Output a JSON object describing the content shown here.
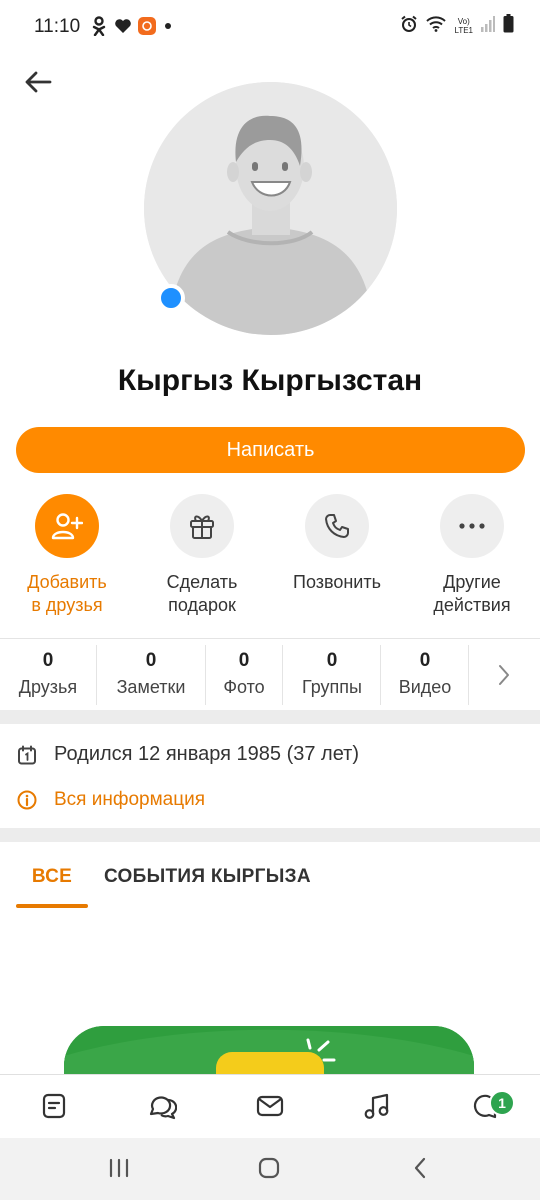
{
  "status_bar": {
    "time": "11:10",
    "network_label": "LTE1",
    "volte_label": "Vo)",
    "icons": [
      "odnoklassniki-icon",
      "heart-icon",
      "app-notification-icon",
      "dot-icon",
      "alarm-icon",
      "wifi-icon",
      "signal-icon",
      "battery-icon"
    ]
  },
  "header": {
    "back_icon": "arrow-left-icon"
  },
  "profile": {
    "name": "Кыргыз Кыргызстан",
    "online": true,
    "online_color": "#1e90ff"
  },
  "primary_button": {
    "label": "Написать",
    "color": "#ff8a00"
  },
  "actions": [
    {
      "label_line1": "Добавить",
      "label_line2": "в друзья",
      "icon": "add-user-icon",
      "primary": true
    },
    {
      "label_line1": "Сделать",
      "label_line2": "подарок",
      "icon": "gift-icon",
      "primary": false
    },
    {
      "label_line1": "Позвонить",
      "label_line2": "",
      "icon": "phone-icon",
      "primary": false
    },
    {
      "label_line1": "Другие",
      "label_line2": "действия",
      "icon": "more-icon",
      "primary": false
    }
  ],
  "counters": [
    {
      "value": "0",
      "label": "Друзья"
    },
    {
      "value": "0",
      "label": "Заметки"
    },
    {
      "value": "0",
      "label": "Фото"
    },
    {
      "value": "0",
      "label": "Группы"
    },
    {
      "value": "0",
      "label": "Видео"
    }
  ],
  "info": {
    "birthday": "Родился 12 января 1985 (37 лет)",
    "all_info_link": "Вся информация"
  },
  "tabs": [
    {
      "label": "ВСЕ",
      "active": true
    },
    {
      "label": "СОБЫТИЯ КЫРГЫЗА",
      "active": false
    }
  ],
  "bottom_nav": {
    "items": [
      "feed-icon",
      "discussions-icon",
      "messages-icon",
      "music-icon",
      "notifications-icon"
    ],
    "notifications_badge": "1"
  },
  "system_nav": {
    "items": [
      "recent-apps-icon",
      "home-icon",
      "back-icon"
    ]
  },
  "colors": {
    "accent": "#ff8a00",
    "accent_text": "#e77a00",
    "badge": "#2ea44f"
  }
}
